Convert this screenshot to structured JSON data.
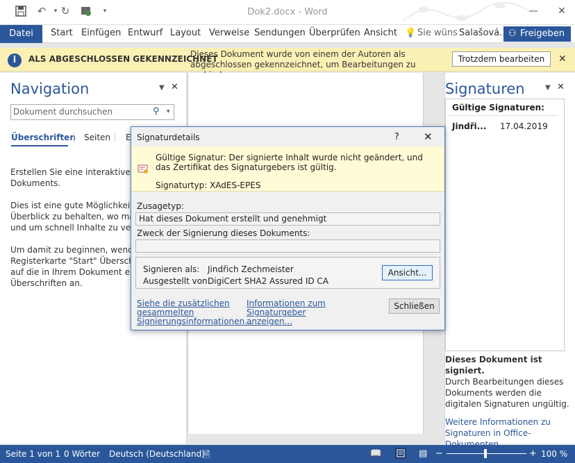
{
  "window": {
    "title": "Dok2.docx - Word"
  },
  "ribbon": {
    "file": "Datei",
    "tabs": [
      "Start",
      "Einfügen",
      "Entwurf",
      "Layout",
      "Verweise",
      "Sendungen",
      "Überprüfen",
      "Ansicht"
    ],
    "tell_me": "Sie wüns",
    "user": "Salašová...",
    "share": "Freigeben"
  },
  "infobar": {
    "title": "ALS ABGESCHLOSSEN GEKENNZEICHNET",
    "message": "Dieses Dokument wurde von einem der Autoren als abgeschlossen gekennzeichnet, um Bearbeitungen zu verhindern.",
    "button": "Trotzdem bearbeiten"
  },
  "navigation": {
    "title": "Navigation",
    "search_placeholder": "Dokument durchsuchen",
    "tabs": [
      "Überschriften",
      "Seiten",
      "E"
    ],
    "paragraphs": [
      "Erstellen Sie eine interaktive Gliede",
      "Dokuments.",
      "Dies ist eine gute Möglichkeit, um",
      "Überblick zu behalten, wo man sich",
      "und um schnell Inhalte zu verschie",
      "Um damit zu beginnen, wenden S",
      "Registerkarte \"Start\" Überschrifte",
      "auf die in Ihrem Dokument enthal",
      "Überschriften an."
    ]
  },
  "signatures": {
    "title": "Signaturen",
    "valid_header": "Gültige Signaturen:",
    "entry_name": "Jindři...",
    "entry_date": "17.04.2019",
    "signed_title": "Dieses Dokument ist signiert.",
    "signed_text": "Durch Bearbeitungen dieses Dokuments werden die digitalen Signaturen ungültig.",
    "more_info": "Weitere Informationen zu Signaturen in Office-Dokumenten..."
  },
  "dialog": {
    "title": "Signaturdetails",
    "help": "?",
    "valid_text": "Gültige Signatur: Der signierte Inhalt wurde nicht geändert, und das Zertifikat des Signaturgebers ist gültig.",
    "sig_type": "Signaturtyp: XAdES-EPES",
    "commitment_label": "Zusagetyp:",
    "commitment_value": "Hat dieses Dokument erstellt und genehmigt",
    "purpose_label": "Zweck der Signierung dieses Dokuments:",
    "purpose_value": "",
    "signed_as_label": "Signieren als:",
    "signed_as_value": "Jindřich Zechmeister",
    "issued_by_label": "Ausgestellt von:",
    "issued_by_value": "DigiCert SHA2 Assured ID CA",
    "view_button": "Ansicht...",
    "link_details": "Siehe die zusätzlichen gesammelten Signierungsinformationen...",
    "link_signer": "Informationen zum Signaturgeber anzeigen...",
    "close_button": "Schließen"
  },
  "status": {
    "page": "Seite 1 von 1",
    "words": "0 Wörter",
    "language": "Deutsch (Deutschland)",
    "zoom": "100 %"
  },
  "colors": {
    "accent": "#2b579a",
    "infobar": "#fbf1b5",
    "dialog_yellow": "#fffbd6"
  }
}
